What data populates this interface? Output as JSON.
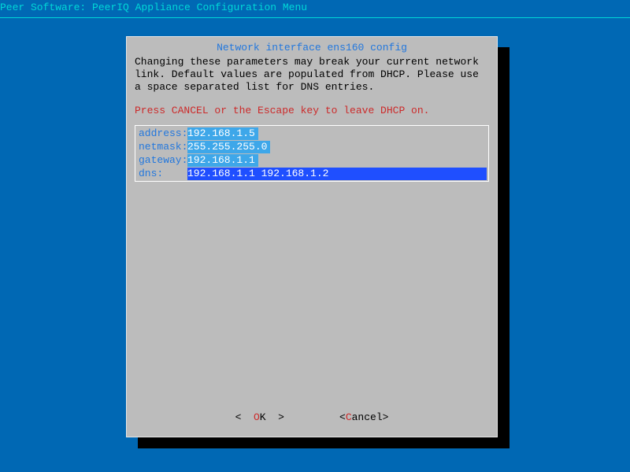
{
  "header": {
    "title": "Peer Software: PeerIQ Appliance Configuration Menu"
  },
  "dialog": {
    "title": "Network interface ens160 config",
    "desc_line1": "Changing these parameters may break your current network",
    "desc_line2": "link. Default values are populated from DHCP. Please use",
    "desc_line3": "a space separated list for DNS entries.",
    "hint": "Press CANCEL or the Escape key to leave DHCP on."
  },
  "form": {
    "rows": [
      {
        "label": "address:",
        "value": "192.168.1.5",
        "active": false
      },
      {
        "label": "netmask:",
        "value": "255.255.255.0",
        "active": false
      },
      {
        "label": "gateway:",
        "value": "192.168.1.1",
        "active": false
      },
      {
        "label": "dns:    ",
        "value": "192.168.1.1 192.168.1.2",
        "active": true
      }
    ]
  },
  "buttons": {
    "ok": {
      "open": "<  ",
      "hot": "O",
      "rest": "K  >"
    },
    "cancel": {
      "open": "<",
      "hot": "C",
      "rest": "ancel>"
    }
  }
}
